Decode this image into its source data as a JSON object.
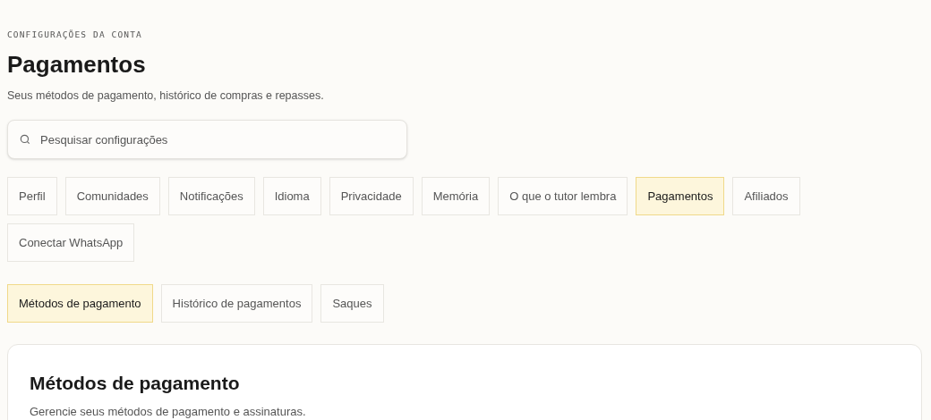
{
  "eyebrow": "CONFIGURAÇÕES DA CONTA",
  "title": "Pagamentos",
  "subtitle": "Seus métodos de pagamento, histórico de compras e repasses.",
  "search": {
    "placeholder": "Pesquisar configurações"
  },
  "tabs": [
    {
      "label": "Perfil",
      "selected": false
    },
    {
      "label": "Comunidades",
      "selected": false
    },
    {
      "label": "Notificações",
      "selected": false
    },
    {
      "label": "Idioma",
      "selected": false
    },
    {
      "label": "Privacidade",
      "selected": false
    },
    {
      "label": "Memória",
      "selected": false
    },
    {
      "label": "O que o tutor lembra",
      "selected": false
    },
    {
      "label": "Pagamentos",
      "selected": true
    },
    {
      "label": "Afiliados",
      "selected": false
    },
    {
      "label": "Conectar WhatsApp",
      "selected": false
    }
  ],
  "subtabs": [
    {
      "label": "Métodos de pagamento",
      "selected": true
    },
    {
      "label": "Histórico de pagamentos",
      "selected": false
    },
    {
      "label": "Saques",
      "selected": false
    }
  ],
  "card": {
    "title": "Métodos de pagamento",
    "subtitle": "Gerencie seus métodos de pagamento e assinaturas."
  }
}
